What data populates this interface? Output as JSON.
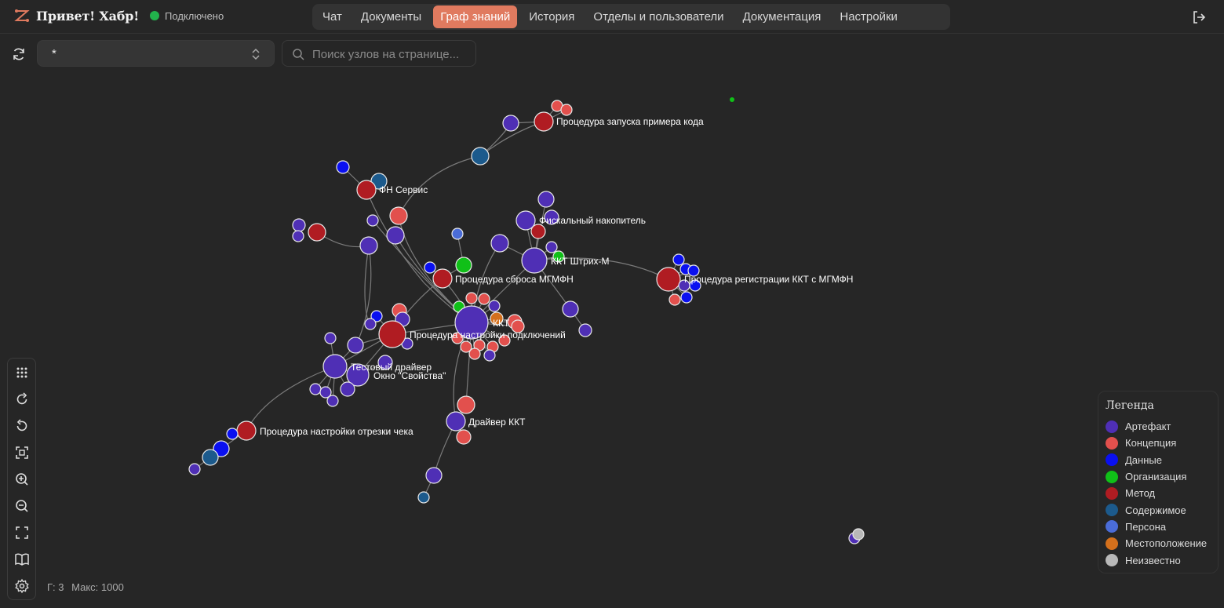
{
  "brand": {
    "title": "Привет! Хабр!",
    "status": "Подключено"
  },
  "tabs": [
    {
      "label": "Чат",
      "active": false
    },
    {
      "label": "Документы",
      "active": false
    },
    {
      "label": "Граф знаний",
      "active": true
    },
    {
      "label": "История",
      "active": false
    },
    {
      "label": "Отделы и пользователи",
      "active": false
    },
    {
      "label": "Документация",
      "active": false
    },
    {
      "label": "Настройки",
      "active": false
    }
  ],
  "controls": {
    "label_select": "*",
    "search_placeholder": "Поиск узлов на странице..."
  },
  "stats": {
    "depth": "Г: 3",
    "max": "Макс: 1000"
  },
  "legend": {
    "title": "Легенда",
    "items": [
      {
        "label": "Артефакт",
        "color": "#4f2fb5"
      },
      {
        "label": "Концепция",
        "color": "#e2504d"
      },
      {
        "label": "Данные",
        "color": "#0a10f0"
      },
      {
        "label": "Организация",
        "color": "#10c018"
      },
      {
        "label": "Метод",
        "color": "#b01c22"
      },
      {
        "label": "Содержимое",
        "color": "#1c5a8c"
      },
      {
        "label": "Персона",
        "color": "#4a6cd8"
      },
      {
        "label": "Местоположение",
        "color": "#d4701c"
      },
      {
        "label": "Неизвестно",
        "color": "#b8b8b8"
      }
    ]
  },
  "graph": {
    "labels": [
      "Процедура запуска примера кода",
      "ФН Сервис",
      "Фискальный накопитель",
      "ККТ Штрих-М",
      "Процедура сброса МГМФН",
      "Процедура регистрации ККТ с МГМФН",
      "ККТ",
      "Процедура настройки подключений",
      "Тестовый драйвер",
      "Окно \"Свойства\"",
      "Драйвер ККТ",
      "Процедура настройки отрезки чека"
    ]
  },
  "toolbar": [
    "grid-icon",
    "reload-icon",
    "undo-icon",
    "fit-view-icon",
    "zoom-in-icon",
    "zoom-out-icon",
    "fullscreen-icon",
    "book-icon",
    "settings-icon"
  ]
}
